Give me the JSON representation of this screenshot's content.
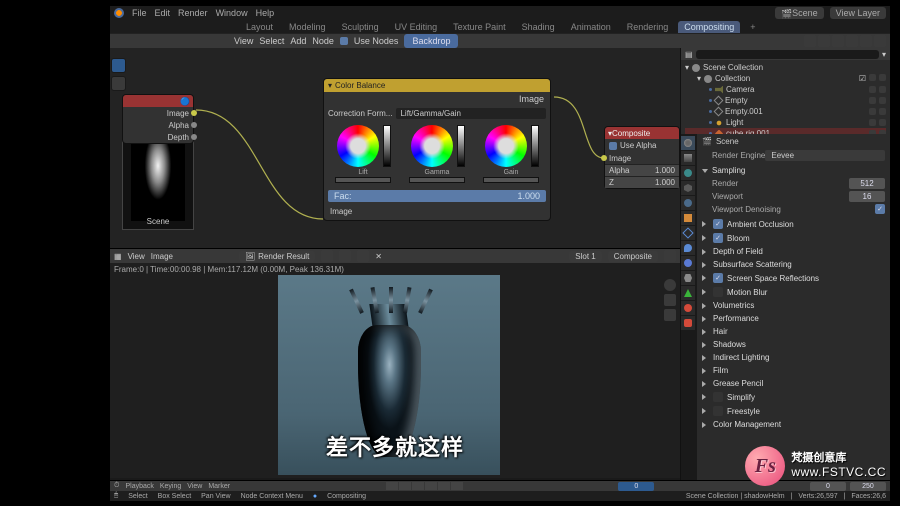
{
  "topmenu": {
    "file": "File",
    "edit": "Edit",
    "render": "Render",
    "window": "Window",
    "help": "Help"
  },
  "workspaces": {
    "layout": "Layout",
    "modeling": "Modeling",
    "sculpting": "Sculpting",
    "uv": "UV Editing",
    "texture": "Texture Paint",
    "shading": "Shading",
    "animation": "Animation",
    "rendering": "Rendering",
    "compositing": "Compositing",
    "plus": "+"
  },
  "scenepill": "Scene",
  "viewlayer": "View Layer",
  "nodehdr": {
    "view": "View",
    "select": "Select",
    "add": "Add",
    "node": "Node",
    "usenodes": "Use Nodes",
    "backdrop": "Backdrop"
  },
  "render_node": {
    "image": "Image",
    "alpha": "Alpha",
    "depth": "Depth",
    "scene": "Scene"
  },
  "cb": {
    "title": "Color Balance",
    "output": "Image",
    "corrformlabel": "Correction Form...",
    "corrform": "Lift/Gamma/Gain",
    "lift": "Lift",
    "gamma": "Gamma",
    "gain": "Gain",
    "fac": "Fac:",
    "facval": "1.000",
    "image": "Image"
  },
  "comp_node": {
    "title": "Composite",
    "usealpha": "Use Alpha",
    "image": "Image",
    "alpha": "Alpha",
    "alphaval": "1.000",
    "z": "Z",
    "zval": "1.000"
  },
  "imged": {
    "view": "View",
    "image": "Image",
    "rr": "Render Result",
    "slot": "Slot 1",
    "composite": "Composite"
  },
  "frameinfo": "Frame:0 | Time:00:00.98 | Mem:117.12M (0.00M, Peak 136.31M)",
  "timeline": {
    "playback": "Playback",
    "keying": "Keying",
    "view": "View",
    "marker": "Marker",
    "frame": "0",
    "start": "0",
    "end": "250"
  },
  "statusbar": {
    "select": "Select",
    "boxselect": "Box Select",
    "panview": "Pan View",
    "contextmenu": "Node Context Menu",
    "compositing": "Compositing",
    "col": "Scene Collection | shadowHelm",
    "verts": "Verts:26,597",
    "faces": "Faces:26,6"
  },
  "outliner": {
    "scenecol": "Scene Collection",
    "collection": "Collection",
    "camera": "Camera",
    "empty": "Empty",
    "empty001": "Empty.001",
    "light": "Light",
    "cuberig": "cube rig.001",
    "scene": "Scene"
  },
  "props": {
    "scenelabel": "Scene",
    "engine_lbl": "Render Engine",
    "engine": "Eevee",
    "sampling": "Sampling",
    "render_lbl": "Render",
    "render_val": "512",
    "viewport_lbl": "Viewport",
    "viewport_val": "16",
    "denoise": "Viewport Denoising",
    "ao": "Ambient Occlusion",
    "bloom": "Bloom",
    "dof": "Depth of Field",
    "sss": "Subsurface Scattering",
    "ssr": "Screen Space Reflections",
    "motion": "Motion Blur",
    "vol": "Volumetrics",
    "perf": "Performance",
    "hair": "Hair",
    "shadows": "Shadows",
    "indirect": "Indirect Lighting",
    "film": "Film",
    "grease": "Grease Pencil",
    "simplify": "Simplify",
    "freestyle": "Freestyle",
    "colmgmt": "Color Management"
  },
  "subtitle": "差不多就这样",
  "watermark": {
    "logo": "Fs",
    "cn": "梵摄创意库",
    "url": "www.FSTVC.CC"
  }
}
